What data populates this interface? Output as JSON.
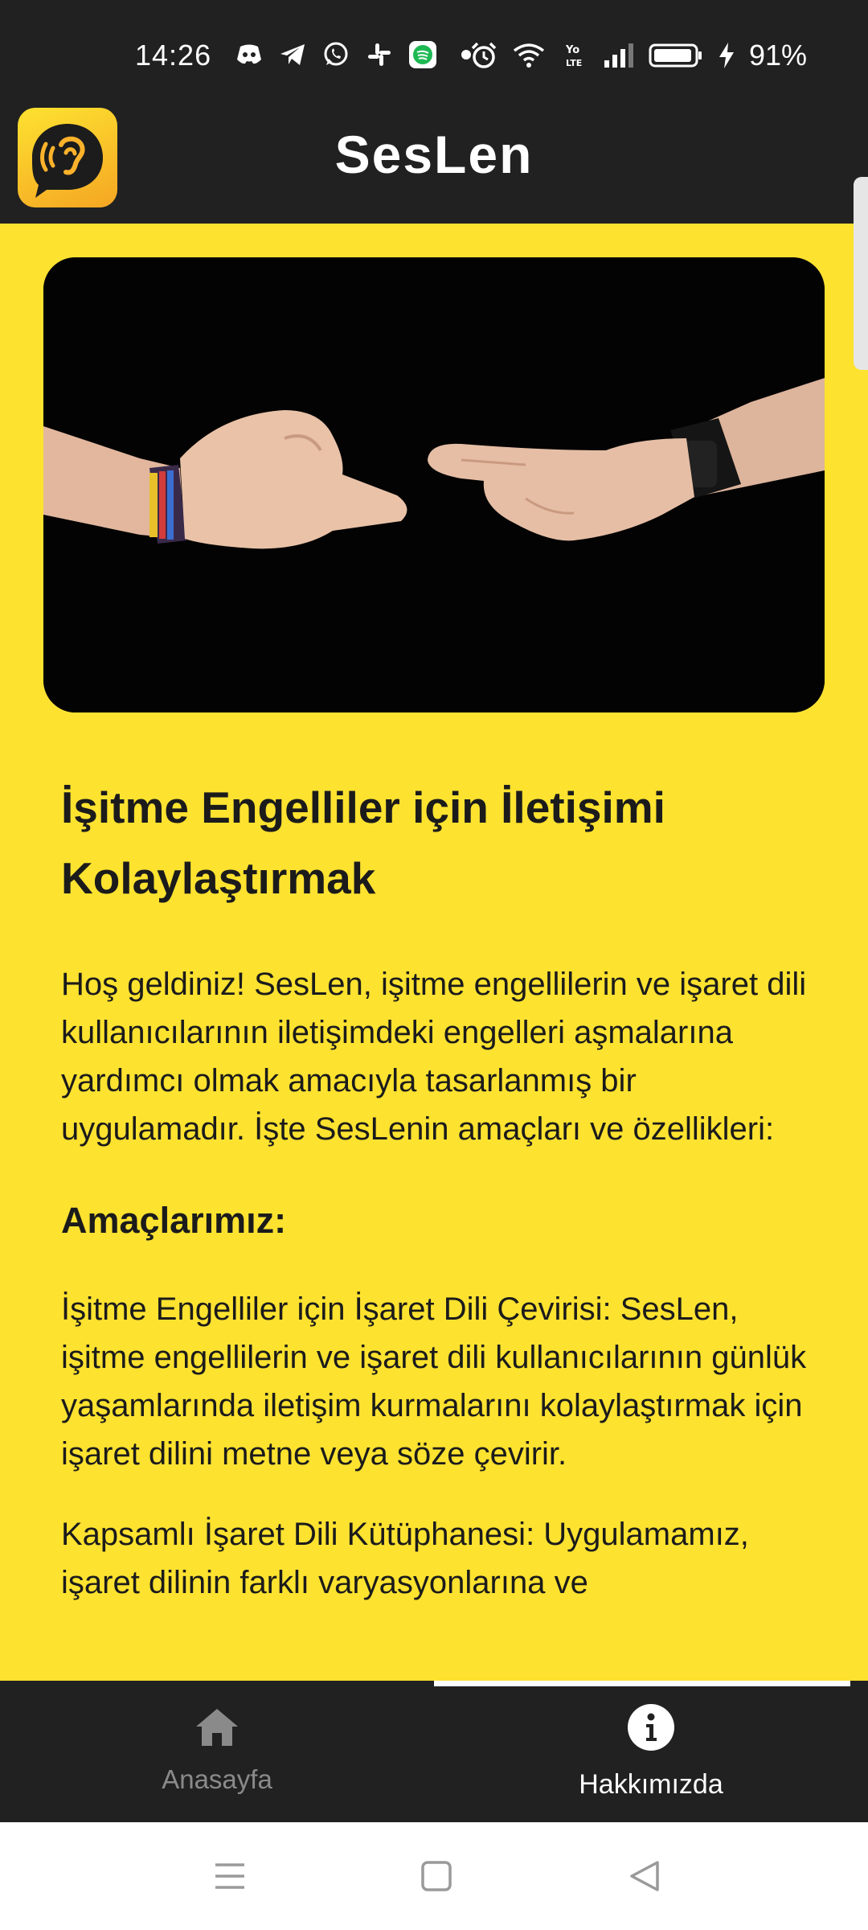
{
  "status_bar": {
    "time": "14:26",
    "battery": "91%",
    "left_icons": [
      "discord-icon",
      "telegram-icon",
      "whatsapp-icon",
      "slack-icon",
      "spotify-icon",
      "dot-icon"
    ],
    "right_icons": [
      "alarm-icon",
      "wifi-icon",
      "volte-icon",
      "signal-icon",
      "battery-icon",
      "charging-icon"
    ]
  },
  "app_bar": {
    "title": "SesLen",
    "logo_icon": "ear-chat-icon"
  },
  "content": {
    "heading": "İşitme Engelliler için İletişimi Kolaylaştırmak",
    "intro": "Hoş geldiniz! SesLen, işitme engellilerin ve işaret dili kullanıcılarının iletişimdeki engelleri aşmalarına yardımcı olmak amacıyla tasarlanmış bir uygulamadır. İşte SesLenin amaçları ve özellikleri:",
    "subheading": "Amaçlarımız:",
    "goal_1": "İşitme Engelliler için İşaret Dili Çevirisi: SesLen, işitme engellilerin ve işaret dili kullanıcılarının günlük yaşamlarında iletişim kurmalarını kolaylaştırmak için işaret dilini metne veya söze çevirir.",
    "goal_2": "Kapsamlı İşaret Dili Kütüphanesi: Uygulamamız, işaret dilinin farklı varyasyonlarına ve"
  },
  "bottom_nav": {
    "items": [
      {
        "label": "Anasayfa",
        "icon": "home-icon",
        "active": false
      },
      {
        "label": "Hakkımızda",
        "icon": "info-icon",
        "active": true
      }
    ]
  },
  "colors": {
    "brand_yellow": "#fde230",
    "bar_dark": "#212121",
    "text_dark": "#1b1b1b",
    "inactive_gray": "#8a8a8a"
  }
}
